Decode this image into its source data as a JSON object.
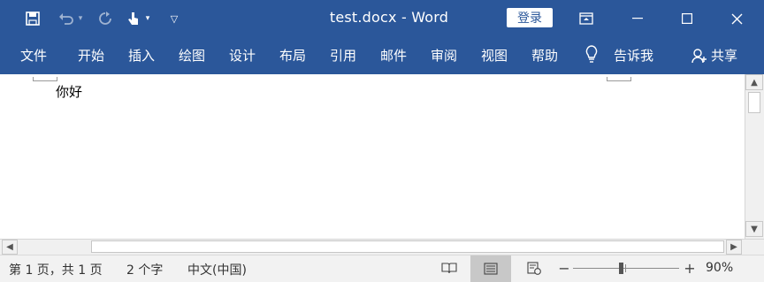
{
  "window": {
    "title": "test.docx  -  Word",
    "login_label": "登录"
  },
  "titlebar_icons": {
    "save": "save-icon",
    "undo": "undo-icon",
    "redo": "redo-icon",
    "touch": "touch-mode-icon",
    "customize": "customize-quick-access-icon",
    "ribbon_display": "ribbon-display-options-icon"
  },
  "ribbon": {
    "tabs": [
      "文件",
      "开始",
      "插入",
      "绘图",
      "设计",
      "布局",
      "引用",
      "邮件",
      "审阅",
      "视图",
      "帮助"
    ],
    "tell_me": "告诉我",
    "share": "共享"
  },
  "document": {
    "text": "你好"
  },
  "status": {
    "page": "第 1 页，共 1 页",
    "words": "2 个字",
    "language": "中文(中国)",
    "zoom": "90%",
    "zoom_level": 0.9
  }
}
